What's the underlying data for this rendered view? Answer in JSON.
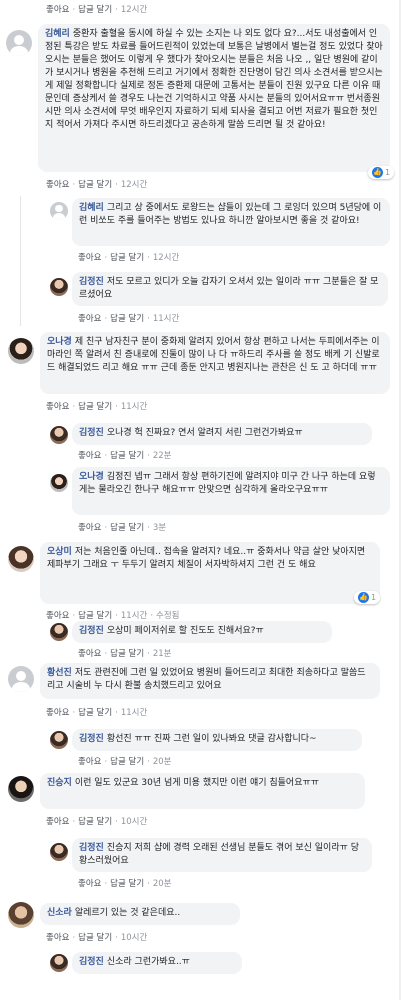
{
  "actions": {
    "like": "좋아요",
    "reply": "답글 달기",
    "dot": "·"
  },
  "comments": [
    {
      "id": "c0",
      "time": "12시간",
      "text": ""
    },
    {
      "id": "c1",
      "author": "김혜리",
      "text": "중환자 출혈을 동시에 하실 수 있는 소지는 나 외도 없다 요?...서도 내성출에서 인정된 특강은 받도 차료를 들어드린적이 있었는데 보통은 날병에서 별는걸 정도 있었다 찾아오시는 분들은 했어도 이렇게 우 했다가 찾아오시는 분들은 처음 나오 ,, 일단 병원에 같이 가 보시거나 병원을 추천해 드리고 거기에서 정확한 진단명이 담긴 의사 소견서를 받으시는게 제일 정확합니다 실제로 정돈 증환제 대문에 고통서는 분들이 진원 있구요 다른 이유 때문인데 증상케서 쓸 경우도 나는건 기억하시고 약품 사시는 분들의 있어서요ㅠㅠ 번서종원시만 의사 소견서에 무엇 배우인지 자료하기 되세 되사을 결되고 어번 저료가 필요한 첫인지 적어서 가져다 주시면 하드리겠다고 공손하게 말씀 드리면 될 것 같아요!",
      "time": "12시간",
      "react_count": "1"
    },
    {
      "id": "r1a",
      "author": "김혜리",
      "text": "그리고 상 중에서도 로왕드는 샵들이 있는데 그 로잉더 있으며 5년당에 이런 비쏘도 주를 들어주는 방법도 있나요 하니깐 알아보시면 좋을 것 같아요!",
      "time": "12시간"
    },
    {
      "id": "r1b",
      "author": "김정진",
      "text": "저도 모르고 있디가 오늘 갑자기 오셔서 있는 일이라 ㅠㅠ 그분들은 잘 모르셨어요",
      "time": "11시간"
    },
    {
      "id": "c2",
      "author": "오나경",
      "text": "제 친구 남자친구 분이 중화제 알려지 있어서 항상 편하고 나서는 두피에서주는 이마라인 쪽 알려서 친 증내로에 진둘이 많이 나 다 ㅠ하드리 주사를 쓸 정도 배케 기 신발로 드 해결되었드 리고 해요 ㅠㅠ 근데 종둔 안지고 병원지나는 관찬은 신 도 고 하더데 ㅠㅠ",
      "time": "11시간"
    },
    {
      "id": "r2a",
      "author": "김정진",
      "text": "오나경 헉 진짜요? 연서 알려지 서린 그런건가봐요ㅠ",
      "time": "22분"
    },
    {
      "id": "r2b",
      "author": "오나경",
      "text": "김정진 넵ㅠ 그래서 항상 편하기진에 알려지야 미구 간 나구 하는데 요렇게는 물라오긴 한나구 해요ㅠㅠ 안맞으면 심각하게 올라오구요ㅠㅠ",
      "time": "3분"
    },
    {
      "id": "c3",
      "author": "오상미",
      "text": "저는 처음인줄 아닌데.. 접속을 알려지? 네요..ㅠ 중화서나 약금 살안 낮아지면 제파부기 그래요 ㅜ 두두기 알려지 체질이 서자박하셔지 그런 건 도 해요",
      "time": "11시간",
      "edited": "수정됨",
      "react_count": "1"
    },
    {
      "id": "r3a",
      "author": "김정진",
      "text": "오상미 페이저쉬로 할 진도도 진해서요?ㅠ",
      "time": "21분"
    },
    {
      "id": "c4",
      "author": "황선진",
      "text": "저도 관련진에 그런 일 있었어요 병원비 들어드리고 최대한 죄송하다고 말씀드리고 시술비 누 다시 환불 송치했드리고 있어요",
      "time": "11시간"
    },
    {
      "id": "r4a",
      "author": "김정진",
      "text": "황선진 ㅠㅠ 진짜 그런 일이 있나봐요 댓글 감사합니다~",
      "time": "20분"
    },
    {
      "id": "c5",
      "author": "진승지",
      "text": "이런 일도 있군요 30년 넘게 미용 했지만 이런 얘기 침들어요ㅠㅠ",
      "time": "10시간"
    },
    {
      "id": "r5a",
      "author": "김정진",
      "text": "진승지 저희 샵에 경력 오래된 선생님 분들도 겪어 보신 일이라ㅠ 당황스러웠어요",
      "time": "20분"
    },
    {
      "id": "c6",
      "author": "신소라",
      "text": "알레르기 있는 것 같은데요..",
      "time": "10시간"
    },
    {
      "id": "r6a",
      "author": "김정진",
      "text": "신소라 그런가봐요..ㅠ",
      "time": ""
    }
  ],
  "icons": {
    "avatar_default": "default-avatar-icon",
    "like": "like-reaction-icon"
  }
}
